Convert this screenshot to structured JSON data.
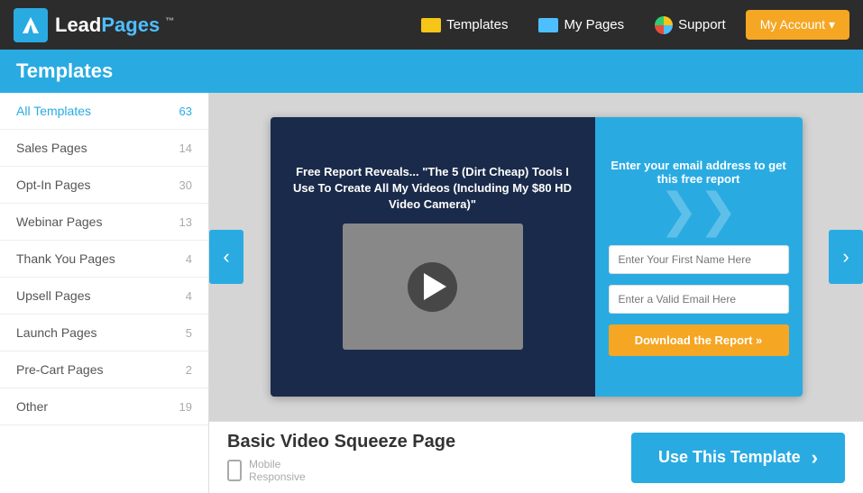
{
  "header": {
    "logo_bold": "Lead",
    "logo_light": "Pages",
    "nav": [
      {
        "id": "templates",
        "label": "Templates"
      },
      {
        "id": "my-pages",
        "label": "My Pages"
      },
      {
        "id": "support",
        "label": "Support"
      }
    ],
    "my_account_label": "My Account ▾"
  },
  "page_title": "Templates",
  "sidebar": {
    "items": [
      {
        "id": "all-templates",
        "label": "All Templates",
        "count": "63",
        "active": true
      },
      {
        "id": "sales-pages",
        "label": "Sales Pages",
        "count": "14",
        "active": false
      },
      {
        "id": "opt-in-pages",
        "label": "Opt-In Pages",
        "count": "30",
        "active": false
      },
      {
        "id": "webinar-pages",
        "label": "Webinar Pages",
        "count": "13",
        "active": false
      },
      {
        "id": "thank-you-pages",
        "label": "Thank You Pages",
        "count": "4",
        "active": false
      },
      {
        "id": "upsell-pages",
        "label": "Upsell Pages",
        "count": "4",
        "active": false
      },
      {
        "id": "launch-pages",
        "label": "Launch Pages",
        "count": "5",
        "active": false
      },
      {
        "id": "pre-cart-pages",
        "label": "Pre-Cart Pages",
        "count": "2",
        "active": false
      },
      {
        "id": "other",
        "label": "Other",
        "count": "19",
        "active": false
      }
    ]
  },
  "template_preview": {
    "left_title": "Free Report Reveals... \"The 5 (Dirt Cheap) Tools I Use To Create All My Videos (Including My $80 HD Video Camera)\"",
    "right_title": "Enter your email address to get this free report",
    "input1_placeholder": "Enter Your First Name Here",
    "input2_placeholder": "Enter a Valid Email Here",
    "cta_label": "Download the Report »",
    "chevron_deco": "❯❯"
  },
  "template_info": {
    "name": "Basic Video Squeeze Page",
    "mobile_label": "Mobile",
    "responsive_label": "Responsive",
    "use_template_label": "Use This Template"
  },
  "carousel": {
    "prev_label": "‹",
    "next_label": "›"
  }
}
